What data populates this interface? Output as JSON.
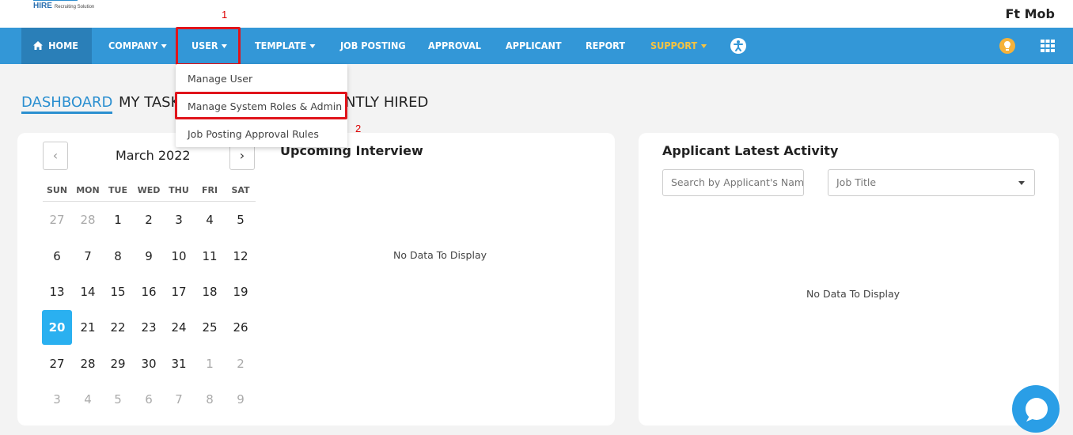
{
  "header": {
    "logo_text": "HIRE",
    "logo_tagline": "Recruiting Solution",
    "user_name": "Ft Mob"
  },
  "annotations": {
    "step1": "1",
    "step2": "2"
  },
  "nav": {
    "home": "HOME",
    "company": "COMPANY",
    "user": "USER",
    "template": "TEMPLATE",
    "job_posting": "JOB POSTING",
    "approval": "APPROVAL",
    "applicant": "APPLICANT",
    "report": "REPORT",
    "support": "SUPPORT"
  },
  "user_menu": {
    "items": [
      "Manage User",
      "Manage System Roles & Admin",
      "Job Posting Approval Rules"
    ]
  },
  "tabs": {
    "dashboard": "DASHBOARD",
    "my_task": "MY TASK",
    "recently_hired": "NTLY HIRED"
  },
  "calendar": {
    "month_label": "March 2022",
    "prev_icon": "‹",
    "next_icon": "›",
    "weekdays": [
      "SUN",
      "MON",
      "TUE",
      "WED",
      "THU",
      "FRI",
      "SAT"
    ],
    "weeks": [
      [
        "27",
        "28",
        "1",
        "2",
        "3",
        "4",
        "5"
      ],
      [
        "6",
        "7",
        "8",
        "9",
        "10",
        "11",
        "12"
      ],
      [
        "13",
        "14",
        "15",
        "16",
        "17",
        "18",
        "19"
      ],
      [
        "20",
        "21",
        "22",
        "23",
        "24",
        "25",
        "26"
      ],
      [
        "27",
        "28",
        "29",
        "30",
        "31",
        "1",
        "2"
      ],
      [
        "3",
        "4",
        "5",
        "6",
        "7",
        "8",
        "9"
      ]
    ],
    "selected": "20"
  },
  "upcoming_interview": {
    "title": "Upcoming Interview",
    "empty_text": "No Data To Display"
  },
  "applicant_activity": {
    "title": "Applicant Latest Activity",
    "search_placeholder": "Search by Applicant's Name",
    "job_title_placeholder": "Job Title",
    "empty_text": "No Data To Display"
  },
  "colors": {
    "nav_bg": "#3397d7",
    "home_bg": "#2a7fb8",
    "accent": "#2b8fd0",
    "highlight_border": "#e0141b",
    "support": "#f5c342",
    "today_bg": "#2ab0f0"
  },
  "icons": {
    "home": "home-icon",
    "accessibility": "accessibility-icon",
    "lightbulb": "lightbulb-icon",
    "grid": "apps-grid-icon",
    "chat": "chat-icon"
  }
}
